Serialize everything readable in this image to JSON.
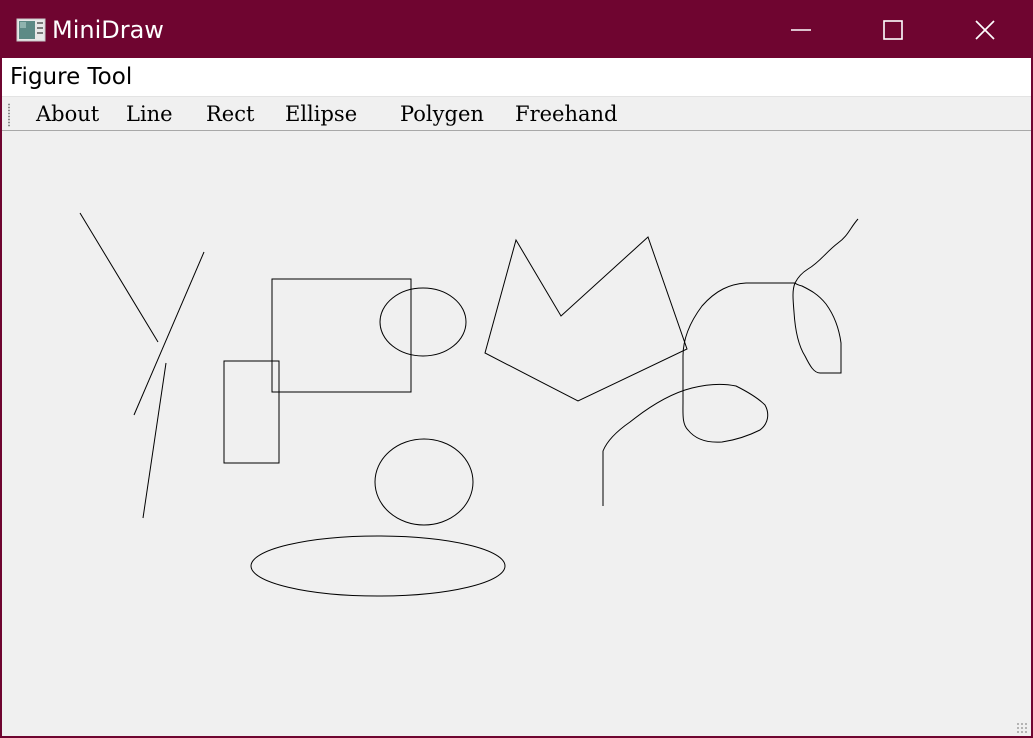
{
  "window": {
    "title": "MiniDraw",
    "icon": "app-icon",
    "controls": [
      "minimize-icon",
      "maximize-icon",
      "close-icon"
    ],
    "colors": {
      "titlebar": "#6f0530",
      "titlebar_text": "#ffffff",
      "canvas": "#f0f0f0",
      "stroke": "#000000"
    }
  },
  "menubar": {
    "items": [
      {
        "label": "Figure Tool"
      }
    ]
  },
  "toolbar": {
    "buttons": [
      {
        "label": "About"
      },
      {
        "label": "Line"
      },
      {
        "label": "Rect"
      },
      {
        "label": "Ellipse"
      },
      {
        "label": "Polygen"
      },
      {
        "label": "Freehand"
      }
    ]
  },
  "canvas": {
    "shape_types": [
      "line",
      "line",
      "line",
      "rect",
      "rect",
      "ellipse",
      "ellipse",
      "ellipse",
      "polygon",
      "freehand",
      "freehand"
    ]
  }
}
